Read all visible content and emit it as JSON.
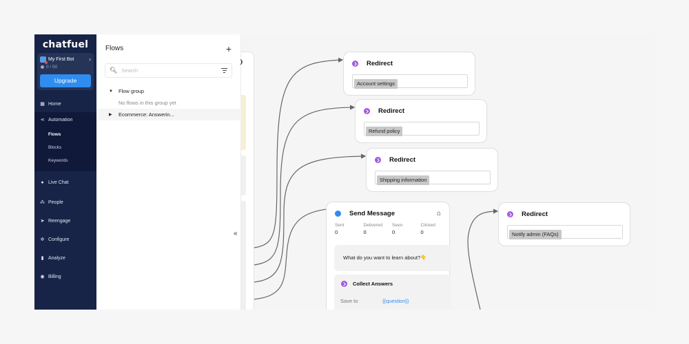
{
  "sidebar": {
    "logo": "chatfuel",
    "bot": {
      "name": "My First Bot",
      "usage": "0 / 50"
    },
    "upgrade_label": "Upgrade",
    "items": [
      {
        "label": "Home",
        "icon": "home-icon"
      },
      {
        "label": "Automation",
        "icon": "share-icon",
        "sub": [
          "Flows",
          "Blocks",
          "Keywords"
        ],
        "active_sub": "Flows"
      },
      {
        "label": "Live Chat",
        "icon": "chat-icon"
      },
      {
        "label": "People",
        "icon": "people-icon"
      },
      {
        "label": "Reengage",
        "icon": "send-icon"
      },
      {
        "label": "Configure",
        "icon": "gear-icon"
      },
      {
        "label": "Analyze",
        "icon": "bar-chart-icon"
      },
      {
        "label": "Billing",
        "icon": "billing-icon"
      }
    ]
  },
  "flows_panel": {
    "title": "Flows",
    "search_placeholder": "Search",
    "tree": [
      {
        "label": "Flow group",
        "expanded": true,
        "empty_text": "No flows in this group yet"
      },
      {
        "label": "Ecommerce: Answerin...",
        "expanded": false
      }
    ]
  },
  "canvas": {
    "redirects": [
      {
        "title": "Redirect",
        "value": "Account settings"
      },
      {
        "title": "Redirect",
        "value": "Refund policy"
      },
      {
        "title": "Redirect",
        "value": "Shipping information"
      },
      {
        "title": "Redirect",
        "value": "Notify admin (FAQs)"
      }
    ],
    "send_message": {
      "title": "Send Message",
      "stats": [
        {
          "label": "Sent",
          "value": "0"
        },
        {
          "label": "Delivered",
          "value": "0"
        },
        {
          "label": "Seen",
          "value": "0"
        },
        {
          "label": "Clicked",
          "value": "0"
        }
      ],
      "message": "What do you want to learn about?👇",
      "collect": {
        "title": "Collect Answers",
        "save_label": "Save to",
        "save_value": "{{question}}"
      }
    },
    "collapse_label": "«"
  },
  "colors": {
    "sidebar_bg": "#172447",
    "accent": "#2f8cf0",
    "redirect_icon": "#a259e0"
  }
}
